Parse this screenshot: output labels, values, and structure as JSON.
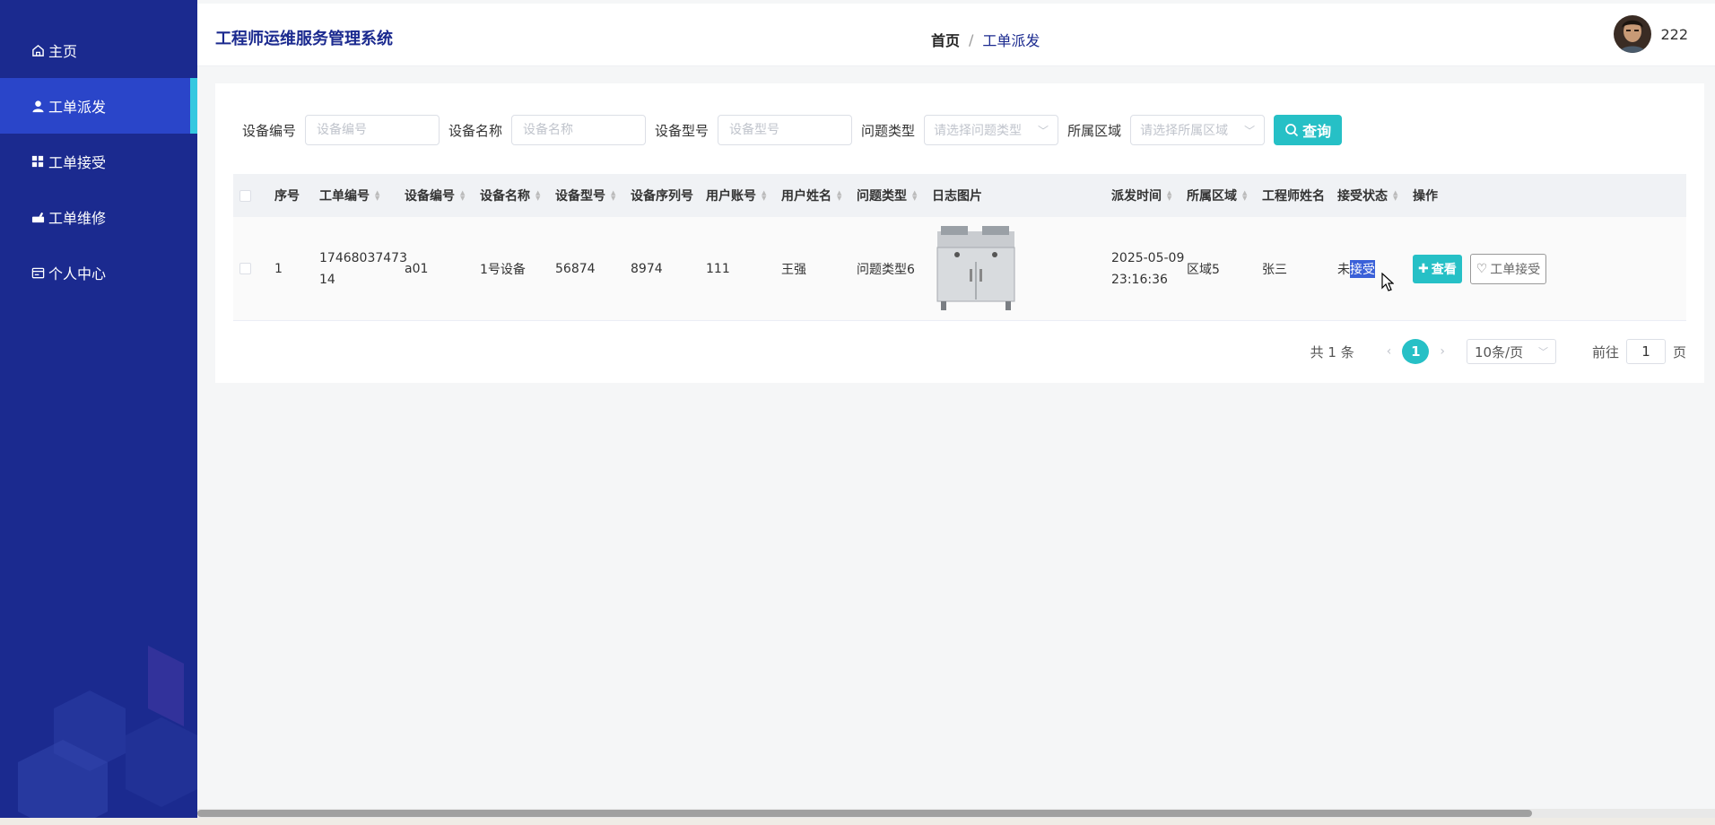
{
  "sidebar": {
    "items": [
      {
        "label": "主页",
        "icon": "home-icon",
        "active": false
      },
      {
        "label": "工单派发",
        "icon": "user-icon",
        "active": true
      },
      {
        "label": "工单接受",
        "icon": "grid-icon",
        "active": false
      },
      {
        "label": "工单维修",
        "icon": "wrench-icon",
        "active": false
      },
      {
        "label": "个人中心",
        "icon": "card-icon",
        "active": false
      }
    ]
  },
  "header": {
    "app_title": "工程师运维服务管理系统",
    "breadcrumb": {
      "home": "首页",
      "separator": "/",
      "current": "工单派发"
    },
    "username": "222"
  },
  "search": {
    "fields": [
      {
        "label": "设备编号",
        "placeholder": "设备编号"
      },
      {
        "label": "设备名称",
        "placeholder": "设备名称"
      },
      {
        "label": "设备型号",
        "placeholder": "设备型号"
      }
    ],
    "selects": [
      {
        "label": "问题类型",
        "placeholder": "请选择问题类型"
      },
      {
        "label": "所属区域",
        "placeholder": "请选择所属区域"
      }
    ],
    "button": "查询"
  },
  "table": {
    "headers": [
      "序号",
      "工单编号",
      "设备编号",
      "设备名称",
      "设备型号",
      "设备序列号",
      "用户账号",
      "用户姓名",
      "问题类型",
      "日志图片",
      "派发时间",
      "所属区域",
      "工程师姓名",
      "接受状态",
      "操作"
    ],
    "rows": [
      {
        "index": "1",
        "order_no_line1": "17468037473",
        "order_no_line2": "14",
        "device_no": "a01",
        "device_name": "1号设备",
        "device_model": "56874",
        "device_serial": "8974",
        "user_account": "111",
        "user_name": "王强",
        "problem_type": "问题类型6",
        "dispatch_date": "2025-05-09",
        "dispatch_time": "23:16:36",
        "region": "区域5",
        "engineer": "张三",
        "status_head": "未",
        "status_tail": "接受",
        "view_button": "查看",
        "accept_button": "工单接受"
      }
    ]
  },
  "pagination": {
    "total": "共 1 条",
    "current_page": "1",
    "page_size": "10条/页",
    "goto_label": "前往",
    "goto_value": "1",
    "page_suffix": "页"
  },
  "colors": {
    "sidebar_bg": "#1b2a8f",
    "sidebar_active": "#2a45c9",
    "accent": "#26c0c6"
  }
}
